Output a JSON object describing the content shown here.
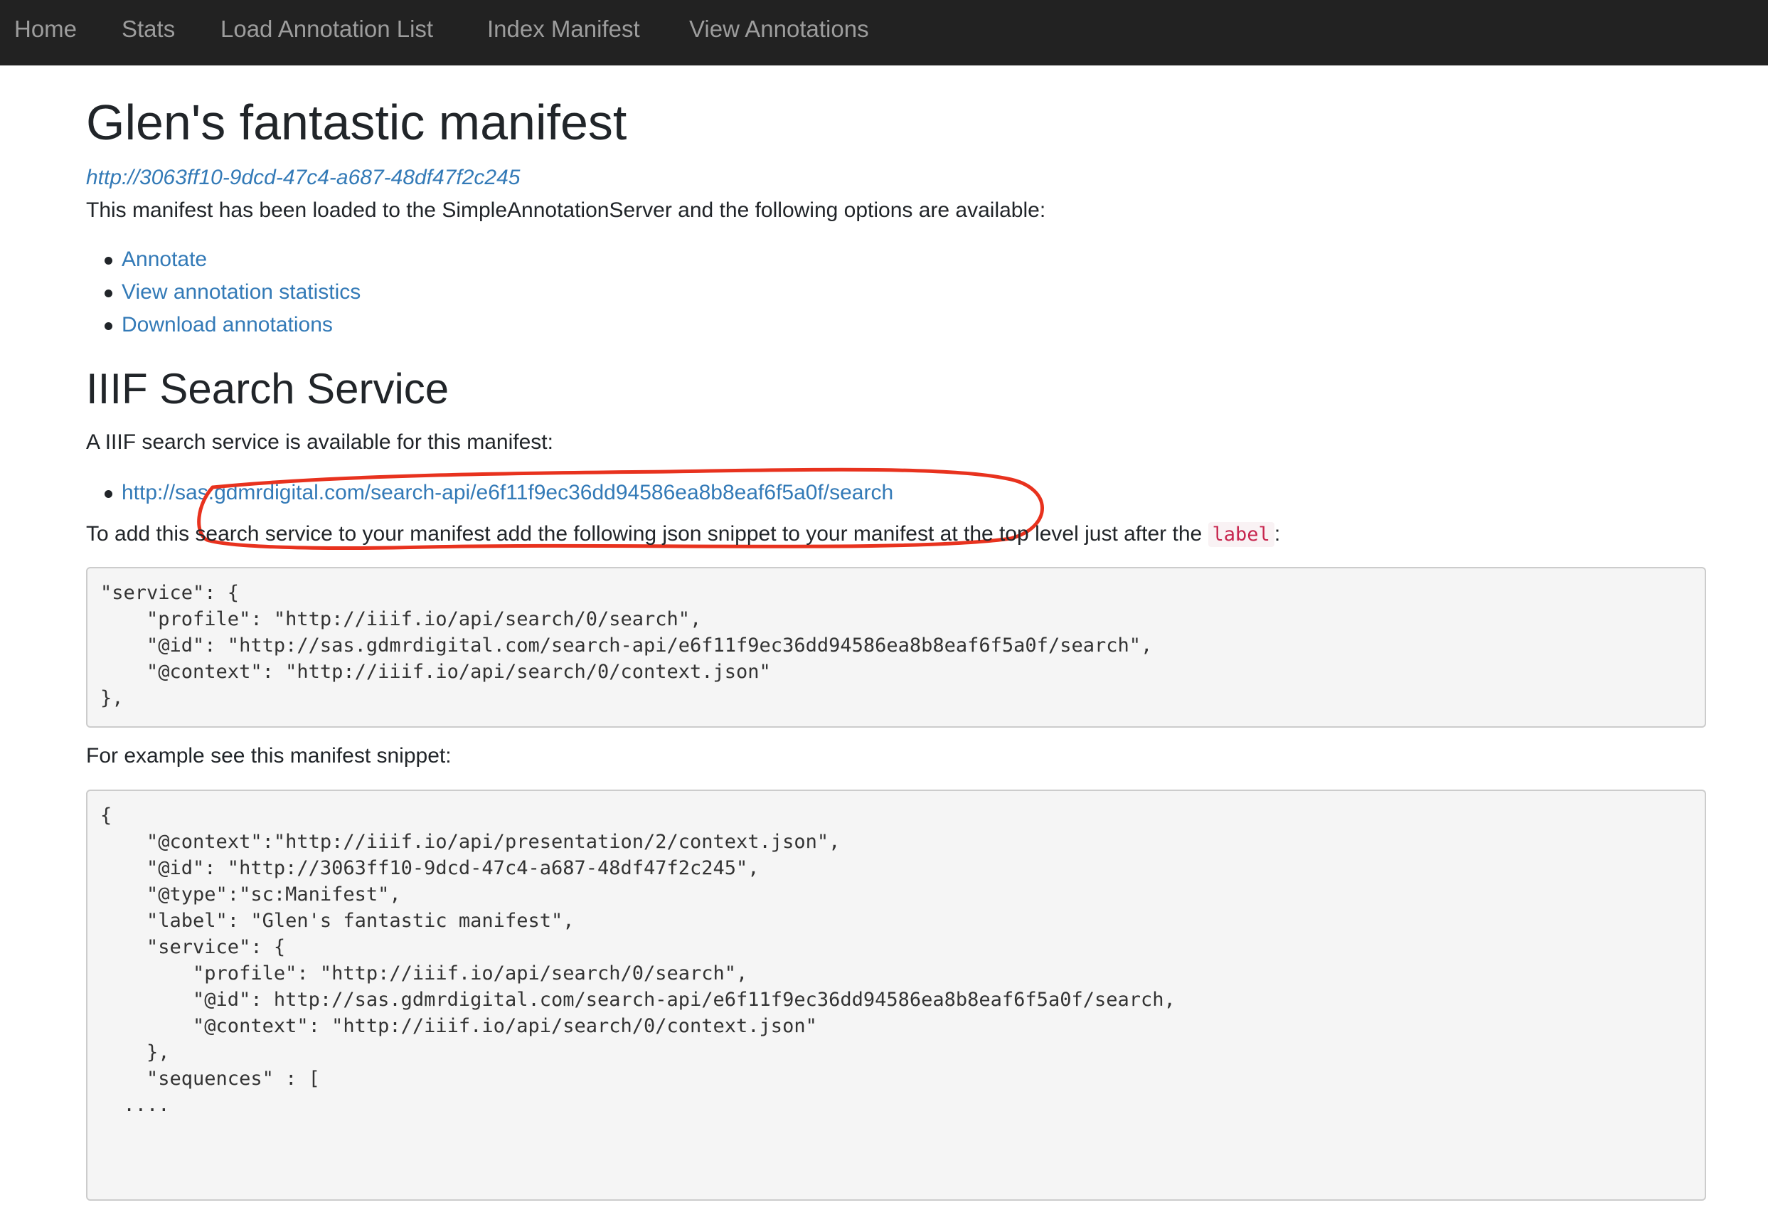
{
  "nav": {
    "items": [
      "Home",
      "Stats",
      "Load Annotation List",
      "Index Manifest",
      "View Annotations"
    ]
  },
  "page": {
    "title": "Glen's fantastic manifest",
    "manifest_id": "http://3063ff10-9dcd-47c4-a687-48df47f2c245",
    "intro": "This manifest has been loaded to the SimpleAnnotationServer and the following options are available:",
    "options": [
      "Annotate",
      "View annotation statistics",
      "Download annotations"
    ]
  },
  "search": {
    "heading": "IIIF Search Service",
    "available_text": "A IIIF search service is available for this manifest:",
    "service_url": "http://sas.gdmrdigital.com/search-api/e6f11f9ec36dd94586ea8b8eaf6f5a0f/search",
    "add_text_before": "To add this search service to your manifest add the following json snippet to your manifest at the top level just after the ",
    "add_text_code": "label",
    "add_text_after": ":",
    "snippet": "\"service\": {\n    \"profile\": \"http://iiif.io/api/search/0/search\",\n    \"@id\": \"http://sas.gdmrdigital.com/search-api/e6f11f9ec36dd94586ea8b8eaf6f5a0f/search\",\n    \"@context\": \"http://iiif.io/api/search/0/context.json\"\n},",
    "example_text": "For example see this manifest snippet:",
    "example_snippet": "{\n    \"@context\":\"http://iiif.io/api/presentation/2/context.json\",\n    \"@id\": \"http://3063ff10-9dcd-47c4-a687-48df47f2c245\",\n    \"@type\":\"sc:Manifest\",\n    \"label\": \"Glen's fantastic manifest\",\n    \"service\": {\n        \"profile\": \"http://iiif.io/api/search/0/search\",\n        \"@id\": http://sas.gdmrdigital.com/search-api/e6f11f9ec36dd94586ea8b8eaf6f5a0f/search,\n        \"@context\": \"http://iiif.io/api/search/0/context.json\"\n    },\n    \"sequences\" : [\n  ...."
  },
  "colors": {
    "navbar_bg": "#222222",
    "nav_text": "#9d9d9d",
    "link": "#337ab7",
    "annotation_circle": "#e8321e"
  }
}
